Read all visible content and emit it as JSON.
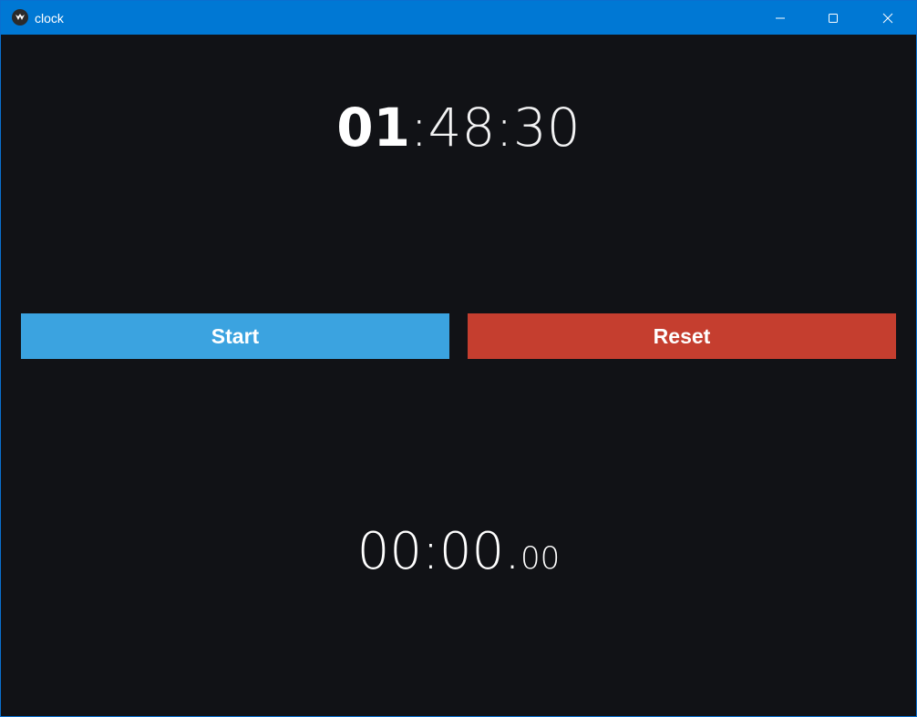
{
  "window": {
    "title": "clock",
    "titlebar_color": "#0078d4",
    "background_color": "#111216",
    "controls": {
      "minimize_icon": "minimize-icon",
      "maximize_icon": "maximize-icon",
      "close_icon": "close-icon"
    }
  },
  "clock": {
    "hours": "01",
    "rest": ":48:30"
  },
  "buttons": {
    "start_label": "Start",
    "start_color": "#3ba3e0",
    "reset_label": "Reset",
    "reset_color": "#c53e2f"
  },
  "stopwatch": {
    "main": "00:00.",
    "fraction": "00"
  }
}
